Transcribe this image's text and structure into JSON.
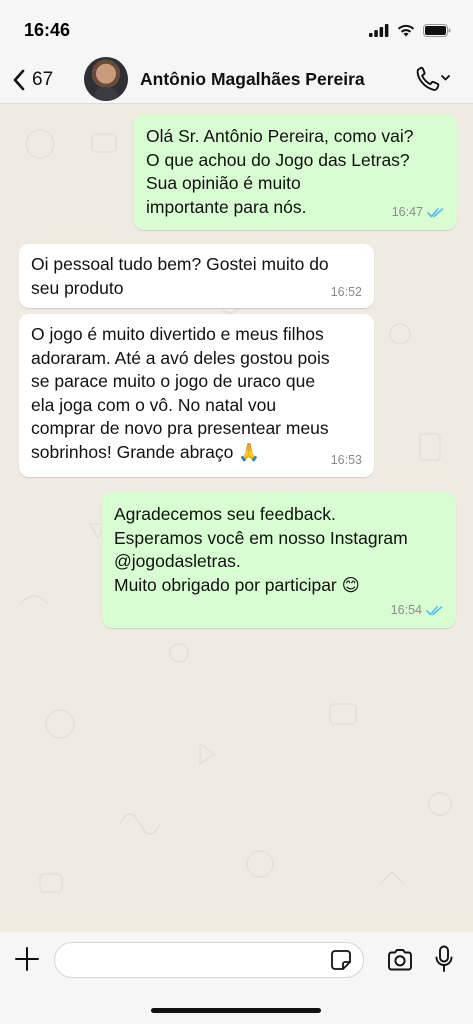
{
  "status_bar": {
    "time": "16:46"
  },
  "header": {
    "back_count": "67",
    "contact_name": "Antônio Magalhães Pereira"
  },
  "messages": [
    {
      "direction": "out",
      "text": "Olá Sr. Antônio Pereira, como vai?\nO que achou do Jogo das Letras?\nSua opinião é muito\nimportante para nós.",
      "time": "16:47",
      "read": true
    },
    {
      "direction": "in",
      "text": "Oi pessoal tudo bem? Gostei muito do\nseu produto",
      "time": "16:52"
    },
    {
      "direction": "in",
      "text": "O jogo é muito divertido e meus filhos\nadoraram. Até a avó deles gostou pois\nse parace muito o jogo de uraco que\nela joga com o vô. No natal vou\ncomprar de novo pra presentear meus\nsobrinhos! Grande abraço 🙏",
      "time": "16:53"
    },
    {
      "direction": "out",
      "text": "Agradecemos seu feedback.\nEsperamos você em nosso Instagram\n@jogodasletras.\nMuito obrigado por participar 😊",
      "time": "16:54",
      "read": true
    }
  ],
  "input": {
    "value": "",
    "placeholder": ""
  },
  "colors": {
    "outgoing_bubble": "#d9fdd3",
    "incoming_bubble": "#ffffff",
    "read_ticks": "#53bdeb",
    "chat_background": "#efeae2"
  },
  "icons": {
    "back": "chevron-left-icon",
    "call": "phone-icon",
    "attach": "plus-icon",
    "sticker": "sticker-icon",
    "camera": "camera-icon",
    "mic": "microphone-icon",
    "read_receipt": "double-check-icon"
  }
}
